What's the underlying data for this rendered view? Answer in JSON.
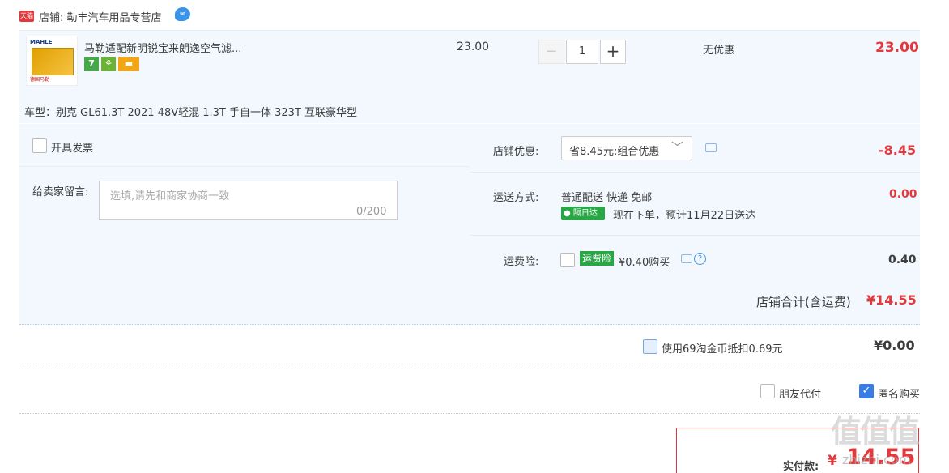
{
  "shop": {
    "badge": "天猫",
    "name": "店铺: 勒丰汽车用品专营店"
  },
  "item": {
    "image_brand": "MAHLE",
    "image_caption": "德国马勒",
    "title": "马勒适配新明锐宝来朗逸空气滤...",
    "service_icons": [
      "7",
      "gift-icon",
      "card-icon"
    ],
    "unit_price": "23.00",
    "quantity": "1",
    "discount_text": "无优惠",
    "line_total": "23.00",
    "car_model": "车型：别克 GL61.3T 2021 48V轻混 1.3T 手自一体 323T 互联豪华型"
  },
  "invoice": {
    "label": "开具发票",
    "checked": false
  },
  "message": {
    "label": "给卖家留言:",
    "placeholder": "选填,请先和商家协商一致",
    "counter": "0/200"
  },
  "shop_discount": {
    "label": "店铺优惠:",
    "selected": "省8.45元:组合优惠",
    "amount": "-8.45"
  },
  "shipping": {
    "label": "运送方式:",
    "method": "普通配送 快递 免邮",
    "badge": "隔日达",
    "eta": "现在下单，预计11月22日送达",
    "amount": "0.00"
  },
  "insurance": {
    "label": "运费险:",
    "badge": "运费险",
    "text": "¥0.40购买",
    "amount": "0.40",
    "checked": false
  },
  "subtotal": {
    "label": "店铺合计(含运费)",
    "amount": "¥14.55"
  },
  "coins": {
    "text": "使用69淘金币抵扣0.69元",
    "amount": "¥0.00",
    "checked": false
  },
  "options": {
    "friend_pay": {
      "label": "朋友代付",
      "checked": false
    },
    "anonymous": {
      "label": "匿名购买",
      "checked": true
    }
  },
  "payment": {
    "label": "实付款:",
    "currency": "¥",
    "amount": "14.55"
  },
  "watermark": {
    "mark": "值值值",
    "url": "zhizhi.com"
  },
  "colors": {
    "accent_red": "#e4393c",
    "panel_blue": "#f2f8fe",
    "badge_green": "#28a745",
    "checkbox_blue": "#3a7ce6"
  }
}
